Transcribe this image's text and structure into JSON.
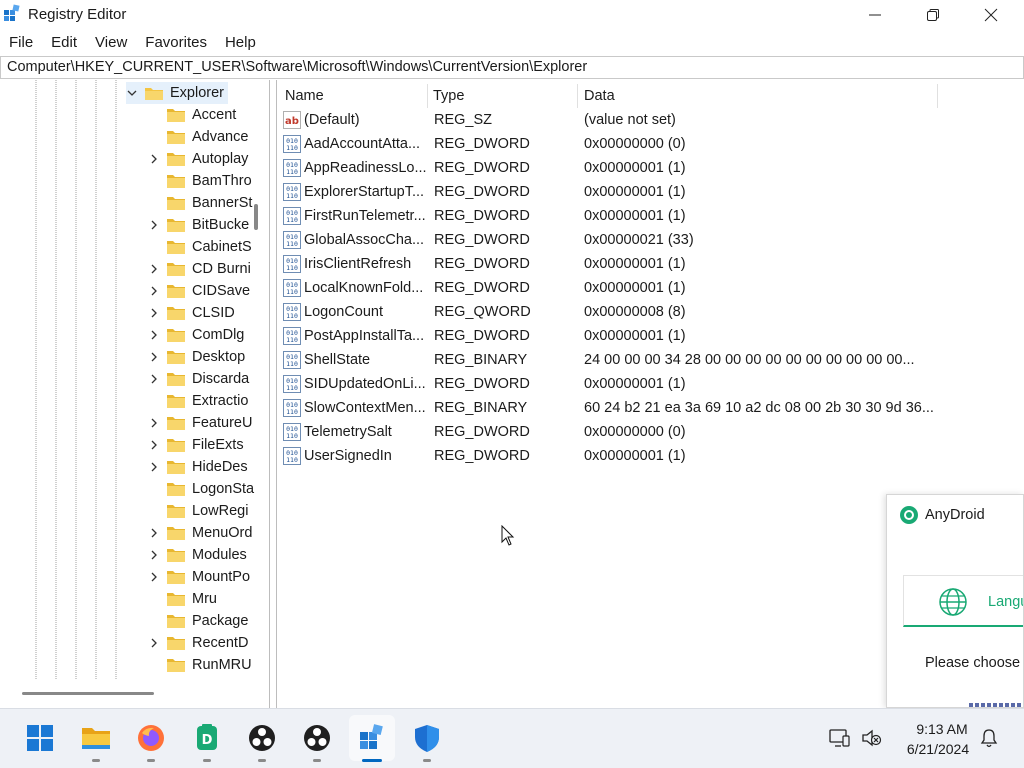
{
  "window": {
    "title": "Registry Editor",
    "icon": "registry-editor-icon"
  },
  "menu": [
    "File",
    "Edit",
    "View",
    "Favorites",
    "Help"
  ],
  "address": "Computer\\HKEY_CURRENT_USER\\Software\\Microsoft\\Windows\\CurrentVersion\\Explorer",
  "tree": {
    "selected": "Explorer",
    "children": [
      {
        "label": "Accent",
        "expandable": false
      },
      {
        "label": "Advance",
        "expandable": false
      },
      {
        "label": "Autoplay",
        "expandable": true
      },
      {
        "label": "BamThro",
        "expandable": false
      },
      {
        "label": "BannerSt",
        "expandable": false
      },
      {
        "label": "BitBucke",
        "expandable": true
      },
      {
        "label": "CabinetS",
        "expandable": false
      },
      {
        "label": "CD Burni",
        "expandable": true
      },
      {
        "label": "CIDSave",
        "expandable": true
      },
      {
        "label": "CLSID",
        "expandable": true
      },
      {
        "label": "ComDlg",
        "expandable": true
      },
      {
        "label": "Desktop",
        "expandable": true
      },
      {
        "label": "Discarda",
        "expandable": true
      },
      {
        "label": "Extractio",
        "expandable": false
      },
      {
        "label": "FeatureU",
        "expandable": true
      },
      {
        "label": "FileExts",
        "expandable": true
      },
      {
        "label": "HideDes",
        "expandable": true
      },
      {
        "label": "LogonSta",
        "expandable": false
      },
      {
        "label": "LowRegi",
        "expandable": false
      },
      {
        "label": "MenuOrd",
        "expandable": true
      },
      {
        "label": "Modules",
        "expandable": true
      },
      {
        "label": "MountPo",
        "expandable": true
      },
      {
        "label": "Mru",
        "expandable": false
      },
      {
        "label": "Package",
        "expandable": false
      },
      {
        "label": "RecentD",
        "expandable": true
      },
      {
        "label": "RunMRU",
        "expandable": false
      }
    ]
  },
  "columns": {
    "name": "Name",
    "type": "Type",
    "data": "Data"
  },
  "values": [
    {
      "name": "(Default)",
      "type": "REG_SZ",
      "data": "(value not set)",
      "icon": "string-value-icon"
    },
    {
      "name": "AadAccountAtta...",
      "type": "REG_DWORD",
      "data": "0x00000000 (0)",
      "icon": "binary-value-icon"
    },
    {
      "name": "AppReadinessLo...",
      "type": "REG_DWORD",
      "data": "0x00000001 (1)",
      "icon": "binary-value-icon"
    },
    {
      "name": "ExplorerStartupT...",
      "type": "REG_DWORD",
      "data": "0x00000001 (1)",
      "icon": "binary-value-icon"
    },
    {
      "name": "FirstRunTelemetr...",
      "type": "REG_DWORD",
      "data": "0x00000001 (1)",
      "icon": "binary-value-icon"
    },
    {
      "name": "GlobalAssocCha...",
      "type": "REG_DWORD",
      "data": "0x00000021 (33)",
      "icon": "binary-value-icon"
    },
    {
      "name": "IrisClientRefresh",
      "type": "REG_DWORD",
      "data": "0x00000001 (1)",
      "icon": "binary-value-icon"
    },
    {
      "name": "LocalKnownFold...",
      "type": "REG_DWORD",
      "data": "0x00000001 (1)",
      "icon": "binary-value-icon"
    },
    {
      "name": "LogonCount",
      "type": "REG_QWORD",
      "data": "0x00000008 (8)",
      "icon": "binary-value-icon"
    },
    {
      "name": "PostAppInstallTa...",
      "type": "REG_DWORD",
      "data": "0x00000001 (1)",
      "icon": "binary-value-icon"
    },
    {
      "name": "ShellState",
      "type": "REG_BINARY",
      "data": "24 00 00 00 34 28 00 00 00 00 00 00 00 00 00 00...",
      "icon": "binary-value-icon"
    },
    {
      "name": "SIDUpdatedOnLi...",
      "type": "REG_DWORD",
      "data": "0x00000001 (1)",
      "icon": "binary-value-icon"
    },
    {
      "name": "SlowContextMen...",
      "type": "REG_BINARY",
      "data": "60 24 b2 21 ea 3a 69 10 a2 dc 08 00 2b 30 30 9d 36...",
      "icon": "binary-value-icon"
    },
    {
      "name": "TelemetrySalt",
      "type": "REG_DWORD",
      "data": "0x00000000 (0)",
      "icon": "binary-value-icon"
    },
    {
      "name": "UserSignedIn",
      "type": "REG_DWORD",
      "data": "0x00000001 (1)",
      "icon": "binary-value-icon"
    }
  ],
  "popup": {
    "title": "AnyDroid",
    "card_label": "Langu",
    "prompt": "Please choose"
  },
  "taskbar": {
    "icons": [
      "start-icon",
      "file-explorer-icon",
      "firefox-icon",
      "anydroid-taskbar-icon",
      "obs-icon",
      "obs-icon-2",
      "registry-editor-taskbar-icon",
      "windows-security-icon"
    ],
    "time": "9:13 AM",
    "date": "6/21/2024"
  },
  "colors": {
    "folder": "#f4c542",
    "accent": "#0067c0",
    "anydroid_green": "#19a974"
  }
}
